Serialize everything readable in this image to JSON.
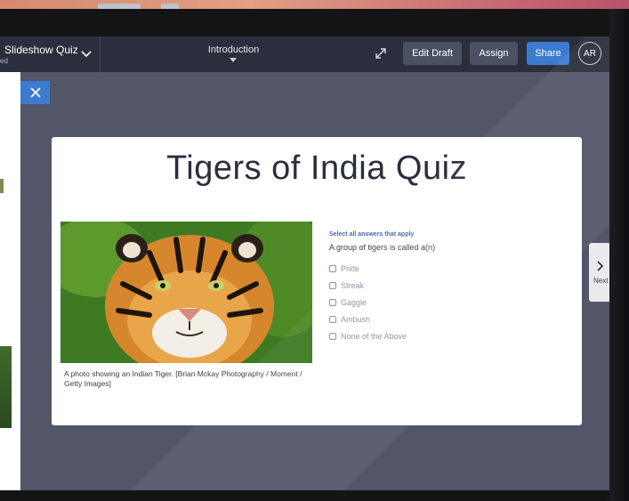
{
  "header": {
    "app_title": "Slideshow Quiz",
    "app_subtitle": "ed",
    "section_title": "Introduction",
    "edit_draft_label": "Edit Draft",
    "assign_label": "Assign",
    "share_label": "Share",
    "avatar_initials": "AR"
  },
  "icons": {
    "title_dropdown": "chevron-down-icon",
    "section_dropdown": "caret-down-icon",
    "expand": "expand-icon",
    "close": "close-icon",
    "next": "chevron-right-icon"
  },
  "colors": {
    "topbar": "#2b2f3d",
    "canvas": "#525668",
    "accent": "#3d7bd1",
    "secondary_button": "#4b5163"
  },
  "slide": {
    "title": "Tigers of India Quiz",
    "image_caption": "A photo showing an Indian Tiger. [Brian Mckay Photography / Moment / Getty Images]",
    "instruction": "Select all answers that apply",
    "question": "A group of tigers is called a(n)",
    "options": [
      "Pride",
      "Streak",
      "Gaggle",
      "Ambush",
      "None of the Above"
    ]
  },
  "nav": {
    "next_label": "Next"
  }
}
